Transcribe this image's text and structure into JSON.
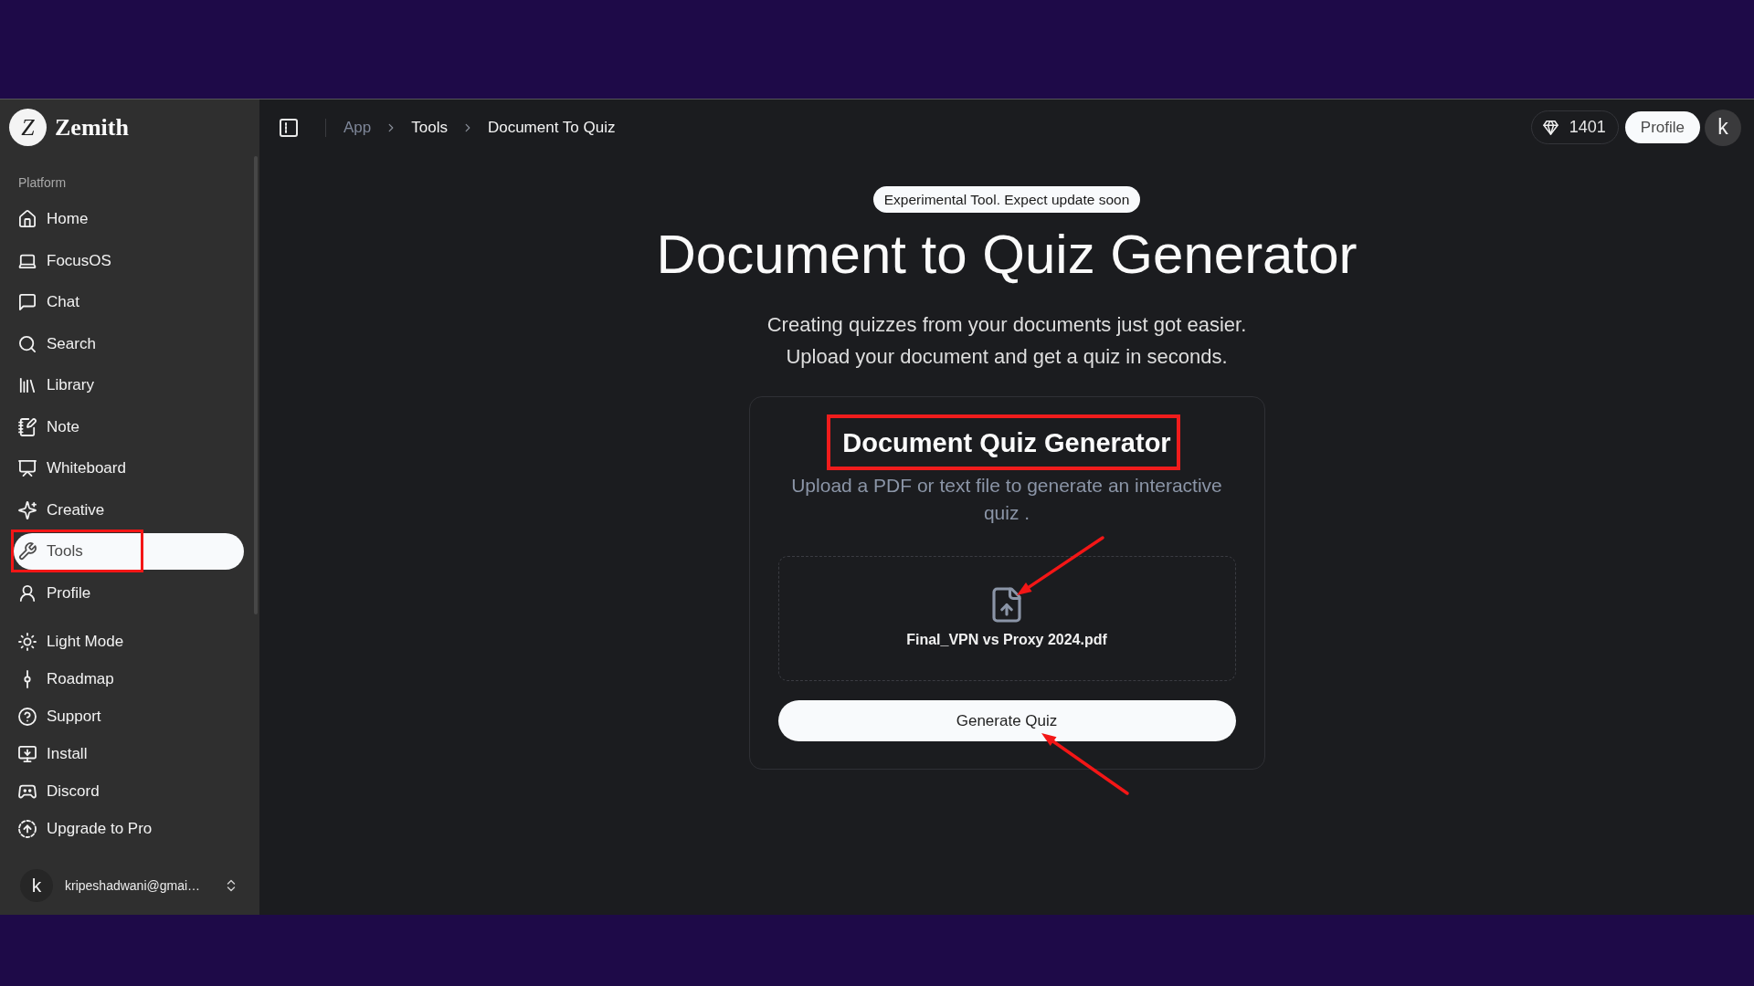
{
  "sidebar": {
    "logo_mark": "Z",
    "brand_name": "Zemith",
    "section_label": "Platform",
    "nav_items": [
      {
        "label": "Home",
        "selected": false,
        "highlighted": false
      },
      {
        "label": "FocusOS",
        "selected": false,
        "highlighted": false
      },
      {
        "label": "Chat",
        "selected": false,
        "highlighted": false
      },
      {
        "label": "Search",
        "selected": false,
        "highlighted": false
      },
      {
        "label": "Library",
        "selected": false,
        "highlighted": false
      },
      {
        "label": "Note",
        "selected": false,
        "highlighted": false
      },
      {
        "label": "Whiteboard",
        "selected": false,
        "highlighted": false
      },
      {
        "label": "Creative",
        "selected": false,
        "highlighted": false
      },
      {
        "label": "Tools",
        "selected": true,
        "highlighted": true
      },
      {
        "label": "Profile",
        "selected": false,
        "highlighted": false
      }
    ],
    "utility_items": [
      {
        "label": "Light Mode",
        "selected": false
      },
      {
        "label": "Roadmap",
        "selected": false
      },
      {
        "label": "Support",
        "selected": false
      },
      {
        "label": "Install",
        "selected": false
      },
      {
        "label": "Discord",
        "selected": false
      },
      {
        "label": "Upgrade to Pro",
        "selected": false
      }
    ],
    "account": {
      "avatar_letter": "k",
      "email": "kripeshadwani@gmai…"
    }
  },
  "top_bar": {
    "breadcrumbs": [
      {
        "label": "App",
        "dimmed": true
      },
      {
        "label": "Tools",
        "dimmed": false
      },
      {
        "label": "Document To Quiz",
        "dimmed": false
      }
    ],
    "credits": "1401",
    "profile_button": "Profile",
    "avatar_letter": "k"
  },
  "main": {
    "badge": "Experimental Tool. Expect update soon",
    "title": "Document to Quiz Generator",
    "subtitle_lines": [
      "Creating quizzes from your documents just got easier.",
      "Upload your document and get a quiz in seconds."
    ],
    "card": {
      "title": "Document Quiz Generator",
      "title_highlighted": true,
      "description": "Upload a PDF or text file to generate an interactive quiz .",
      "upload": {
        "file_name": "Final_VPN vs Proxy 2024.pdf",
        "arrow": true
      },
      "generate_button": {
        "label": "Generate Quiz",
        "arrow": true
      }
    }
  }
}
